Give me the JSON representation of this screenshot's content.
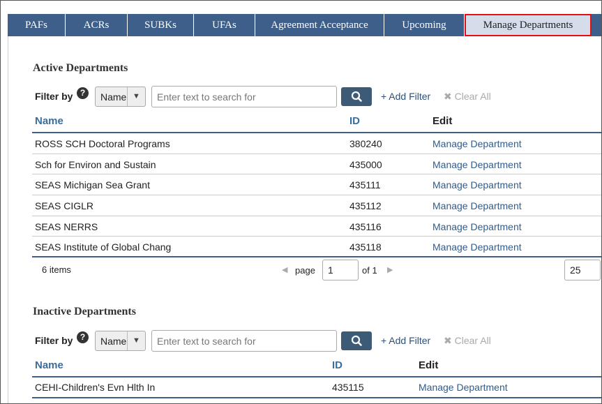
{
  "tabs": [
    {
      "label": "PAFs"
    },
    {
      "label": "ACRs"
    },
    {
      "label": "SUBKs"
    },
    {
      "label": "UFAs"
    },
    {
      "label": "Agreement Acceptance"
    },
    {
      "label": "Upcoming"
    },
    {
      "label": "Manage Departments",
      "active": true
    }
  ],
  "active_section": {
    "title": "Active Departments",
    "filter": {
      "label": "Filter by",
      "help_icon": "question-circle-icon",
      "field": "Name",
      "placeholder": "Enter text to search for",
      "search_icon": "magnifier-icon",
      "add_filter": "+ Add Filter",
      "clear_all": "✖ Clear All"
    },
    "columns": [
      "Name",
      "ID",
      "Edit"
    ],
    "rows": [
      {
        "name": "ROSS SCH Doctoral Programs",
        "id": "380240",
        "edit": "Manage Department"
      },
      {
        "name": "Sch for Environ and Sustain",
        "id": "435000",
        "edit": "Manage Department"
      },
      {
        "name": "SEAS Michigan Sea Grant",
        "id": "435111",
        "edit": "Manage Department"
      },
      {
        "name": "SEAS CIGLR",
        "id": "435112",
        "edit": "Manage Department"
      },
      {
        "name": "SEAS NERRS",
        "id": "435116",
        "edit": "Manage Department"
      },
      {
        "name": "SEAS Institute of Global Chang",
        "id": "435118",
        "edit": "Manage Department"
      }
    ],
    "pager": {
      "items": "6 items",
      "page_label": "page",
      "page_value": "1",
      "of_label": "of 1",
      "page_size": "25"
    }
  },
  "inactive_section": {
    "title": "Inactive Departments",
    "filter": {
      "label": "Filter by",
      "help_icon": "question-circle-icon",
      "field": "Name",
      "placeholder": "Enter text to search for",
      "search_icon": "magnifier-icon",
      "add_filter": "+ Add Filter",
      "clear_all": "✖ Clear All"
    },
    "columns": [
      "Name",
      "ID",
      "Edit"
    ],
    "rows": [
      {
        "name": "CEHI-Children's Evn Hlth In",
        "id": "435115",
        "edit": "Manage Department"
      }
    ]
  },
  "colors": {
    "tab_bar": "#3e5f8a",
    "active_tab": "#d5dcea",
    "active_tab_outline": "#e01010",
    "link": "#2f5c8f",
    "search_button": "#3d5a77"
  }
}
